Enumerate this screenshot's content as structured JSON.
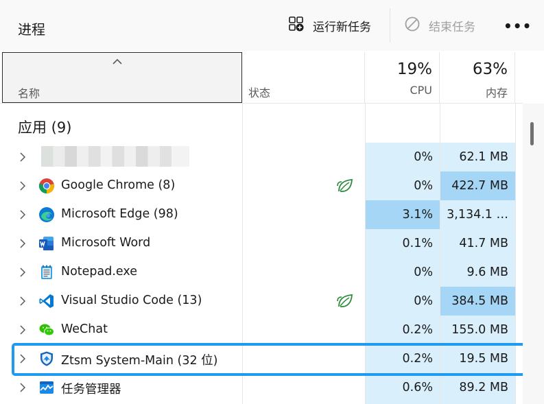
{
  "title": "进程",
  "toolbar": {
    "run_new_task_label": "运行新任务",
    "end_task_label": "结束任务",
    "more_label": "•••"
  },
  "columns": {
    "name": "名称",
    "status": "状态",
    "cpu_label": "CPU",
    "cpu_total": "19%",
    "memory_label": "内存",
    "memory_total": "63%"
  },
  "section": {
    "title": "应用 (9)"
  },
  "rows": [
    {
      "name": "",
      "icon": "blurred-app-icon",
      "efficiency": false,
      "cpu": "0%",
      "memory": "62.1 MB",
      "blurred": true
    },
    {
      "name": "Google Chrome (8)",
      "icon": "chrome-icon",
      "efficiency": true,
      "cpu": "0%",
      "memory": "422.7 MB"
    },
    {
      "name": "Microsoft Edge (98)",
      "icon": "edge-icon",
      "efficiency": false,
      "cpu": "3.1%",
      "memory": "3,134.1 …"
    },
    {
      "name": "Microsoft Word",
      "icon": "word-icon",
      "efficiency": false,
      "cpu": "0.1%",
      "memory": "41.7 MB"
    },
    {
      "name": "Notepad.exe",
      "icon": "notepad-icon",
      "efficiency": false,
      "cpu": "0%",
      "memory": "9.6 MB"
    },
    {
      "name": "Visual Studio Code (13)",
      "icon": "vscode-icon",
      "efficiency": true,
      "cpu": "0%",
      "memory": "384.5 MB"
    },
    {
      "name": "WeChat",
      "icon": "wechat-icon",
      "efficiency": false,
      "cpu": "0.2%",
      "memory": "155.0 MB"
    },
    {
      "name": "Ztsm System-Main (32 位)",
      "icon": "ztsm-shield-icon",
      "efficiency": false,
      "cpu": "0.2%",
      "memory": "19.5 MB",
      "highlighted": true
    },
    {
      "name": "任务管理器",
      "icon": "task-manager-icon",
      "efficiency": false,
      "cpu": "0.6%",
      "memory": "89.2 MB"
    }
  ],
  "colors": {
    "heat_light": "#d9effc",
    "heat_medium": "#c2e4f9",
    "heat_strong": "#a6d6f5",
    "highlight_border": "#1e9bf0",
    "efficiency_green": "#2e8b3e"
  }
}
